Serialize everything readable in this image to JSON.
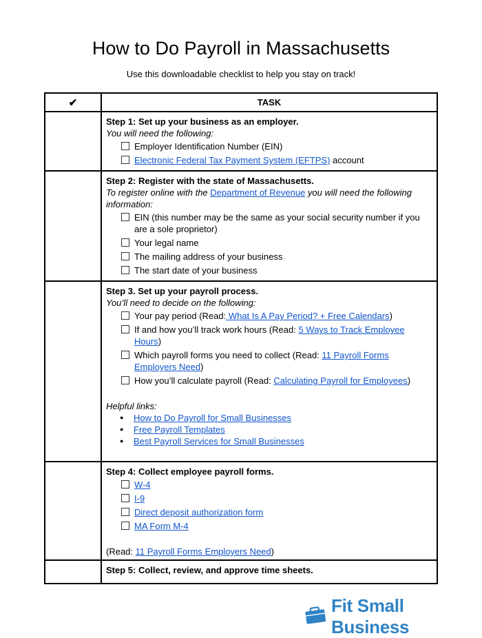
{
  "header": {
    "title": "How to Do Payroll in Massachusetts",
    "subtitle": "Use this downloadable checklist to help you stay on track!"
  },
  "table": {
    "columns": {
      "check": "✔",
      "task": "TASK"
    },
    "steps": [
      {
        "title": "Step 1: Set up your business as an employer.",
        "intro": "You will need the following:",
        "items": [
          {
            "text": "Employer Identification Number (EIN)"
          },
          {
            "link": "Electronic Federal Tax Payment System (EFTPS)",
            "after": " account"
          }
        ]
      },
      {
        "title": "Step 2: Register with the state of Massachusetts.",
        "intro_before": "To register online with the ",
        "intro_link": "Department of Revenue",
        "intro_after": " you will need the following information:",
        "items": [
          {
            "text": "EIN (this number may be the same as your social security number if you are a sole proprietor)"
          },
          {
            "text": "Your legal name"
          },
          {
            "text": "The mailing address of your business"
          },
          {
            "text": "The start date of your business"
          }
        ]
      },
      {
        "title": "Step 3. Set up your payroll process.",
        "intro": "You’ll need to decide on the following:",
        "items": [
          {
            "before": "Your pay period (Read:",
            "link": " What Is A Pay Period? + Free Calendars",
            "after": ")"
          },
          {
            "before": "If and how you’ll track work hours (Read: ",
            "link": "5 Ways to Track Employee Hours",
            "after": ")"
          },
          {
            "before": "Which payroll forms you need to collect (Read: ",
            "link": "11 Payroll Forms Employers Need",
            "after": ")"
          },
          {
            "before": "How you’ll calculate payroll (Read: ",
            "link": "Calculating Payroll for Employees",
            "after": ")"
          }
        ],
        "helpful_label": "Helpful links:",
        "helpful_links": [
          "How to Do Payroll for Small Businesses",
          "Free Payroll Templates",
          "Best Payroll Services for Small Businesses"
        ]
      },
      {
        "title": "Step 4: Collect employee payroll forms.",
        "items": [
          {
            "link": "W-4"
          },
          {
            "link": "I-9"
          },
          {
            "link": "Direct deposit authorization form"
          },
          {
            "link": "MA Form M-4"
          }
        ],
        "read_before": "(Read: ",
        "read_link": "11 Payroll Forms Employers Need",
        "read_after": ")"
      },
      {
        "title": "Step 5: Collect, review, and approve time sheets."
      }
    ]
  },
  "footer": {
    "logo_icon": "briefcase-icon",
    "logo_text": "Fit Small Business",
    "brand_color": "#2f83c5"
  },
  "colors": {
    "link": "#1155cc",
    "border": "#000000"
  }
}
